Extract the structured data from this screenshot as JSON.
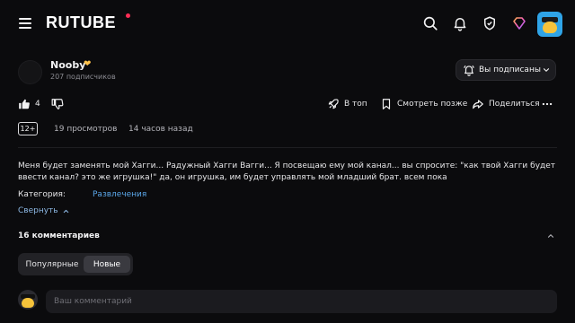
{
  "header": {
    "logo": "RUTUBE",
    "icons": [
      "menu-icon",
      "search-icon",
      "bell-icon",
      "shield-icon",
      "diamond-icon"
    ],
    "colors": {
      "background": "#0b0b0d",
      "logo_dot": "#ff2d55",
      "avatar_bg": "#2fa4e7"
    }
  },
  "channel": {
    "name": "Nooby",
    "subscribers": "207 подписчиков",
    "subscribed_label": "Вы подписаны"
  },
  "actions": {
    "likes": "4",
    "top_label": "В топ",
    "watch_later_label": "Смотреть позже",
    "share_label": "Поделиться"
  },
  "meta": {
    "age_rating": "12+",
    "views": "19 просмотров",
    "published": "14 часов назад"
  },
  "description": {
    "text": "Меня будет заменять мой Хагги... Радужный Хагги Вагги... Я посвещаю ему мой канал... вы спросите: \"как твой Хагги будет ввести канал? это же игрушка!\" да, он игрушка, им будет управлять мой младший брат. всем пока",
    "category_label": "Категория:",
    "category_value": "Развлечения",
    "collapse_label": "Свернуть"
  },
  "comments": {
    "count_label": "16 комментариев",
    "sort_options": [
      "Популярные",
      "Новые"
    ],
    "selected_sort": "Новые",
    "input_placeholder": "Ваш комментарий"
  }
}
